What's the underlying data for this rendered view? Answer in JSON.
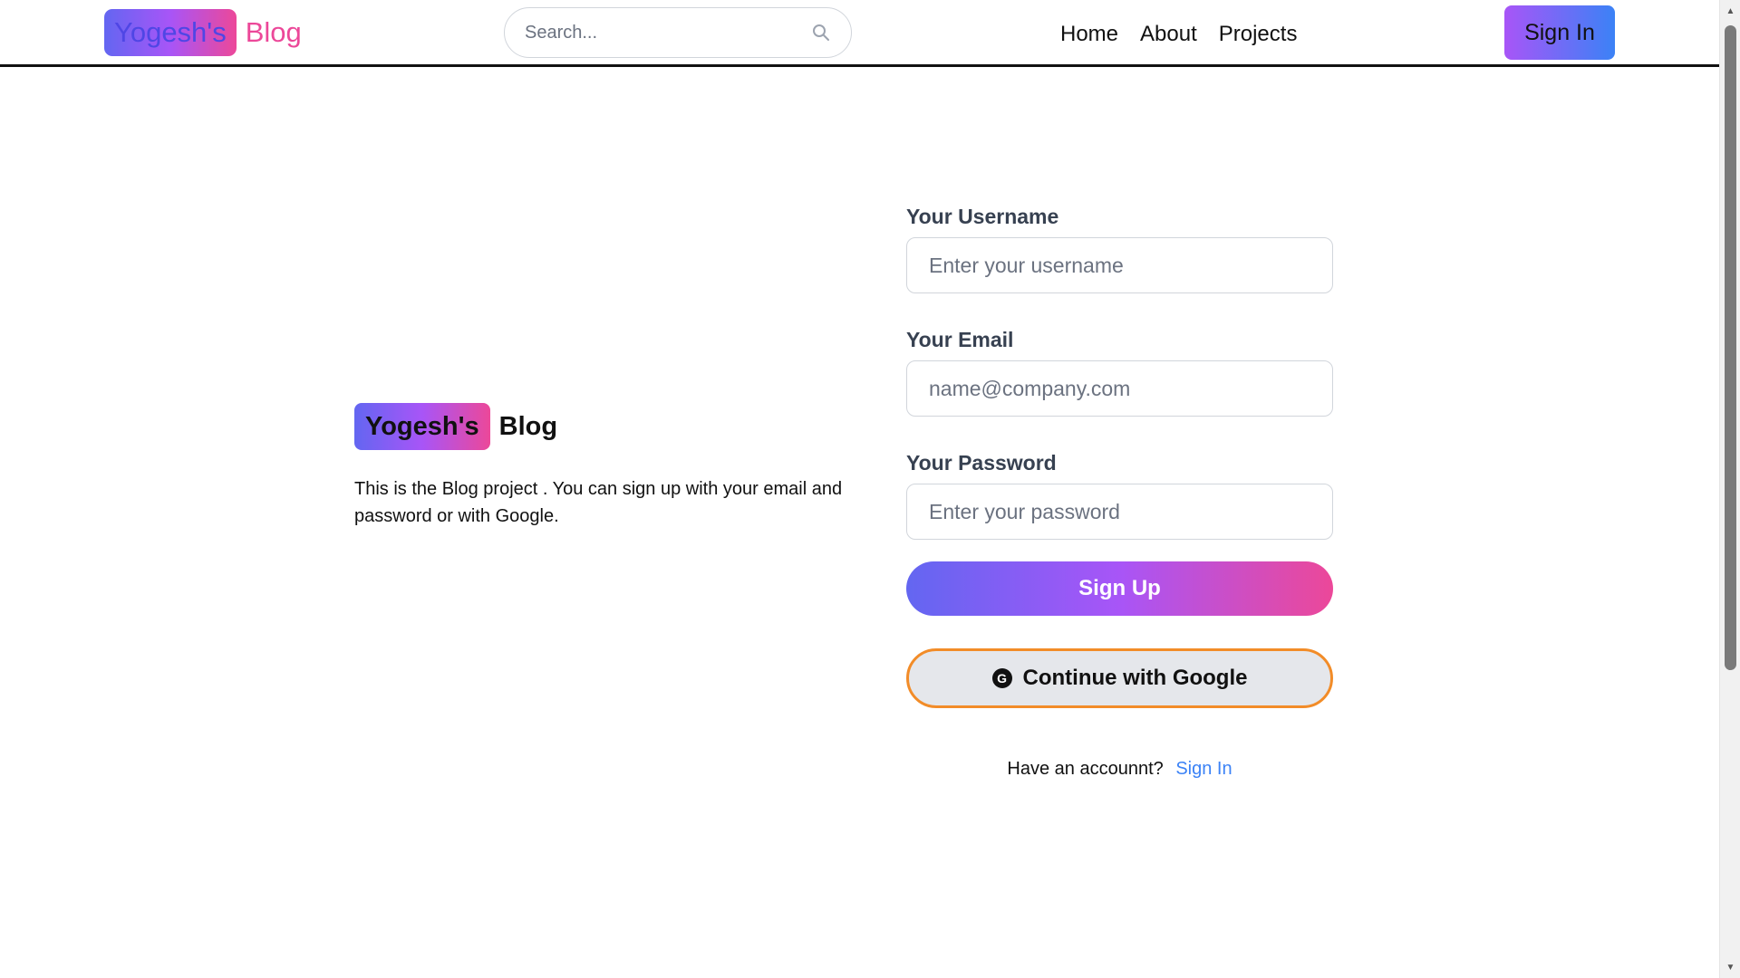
{
  "header": {
    "brand_badge": "Yogesh's",
    "brand_word": "Blog",
    "search_placeholder": "Search...",
    "nav": [
      {
        "label": "Home"
      },
      {
        "label": "About"
      },
      {
        "label": "Projects"
      }
    ],
    "signin_label": "Sign In"
  },
  "intro": {
    "brand_badge": "Yogesh's",
    "brand_word": "Blog",
    "description": "This is the Blog project . You can sign up with your email and password or with Google."
  },
  "form": {
    "username_label": "Your Username",
    "username_placeholder": "Enter your username",
    "email_label": "Your Email",
    "email_placeholder": "name@company.com",
    "password_label": "Your Password",
    "password_placeholder": "Enter your password",
    "signup_label": "Sign Up",
    "google_label": "Continue with Google",
    "google_icon_glyph": "G",
    "account_question": "Have an accounnt?",
    "account_link": "Sign In"
  },
  "colors": {
    "brand_gradient": [
      "#6366f1",
      "#a855f7",
      "#ec4899"
    ],
    "signin_gradient": [
      "#a855f7",
      "#3b82f6"
    ],
    "google_border": "#f28c28",
    "link": "#3b82f6"
  },
  "icons": {
    "search": "search-icon",
    "google": "google-icon"
  }
}
